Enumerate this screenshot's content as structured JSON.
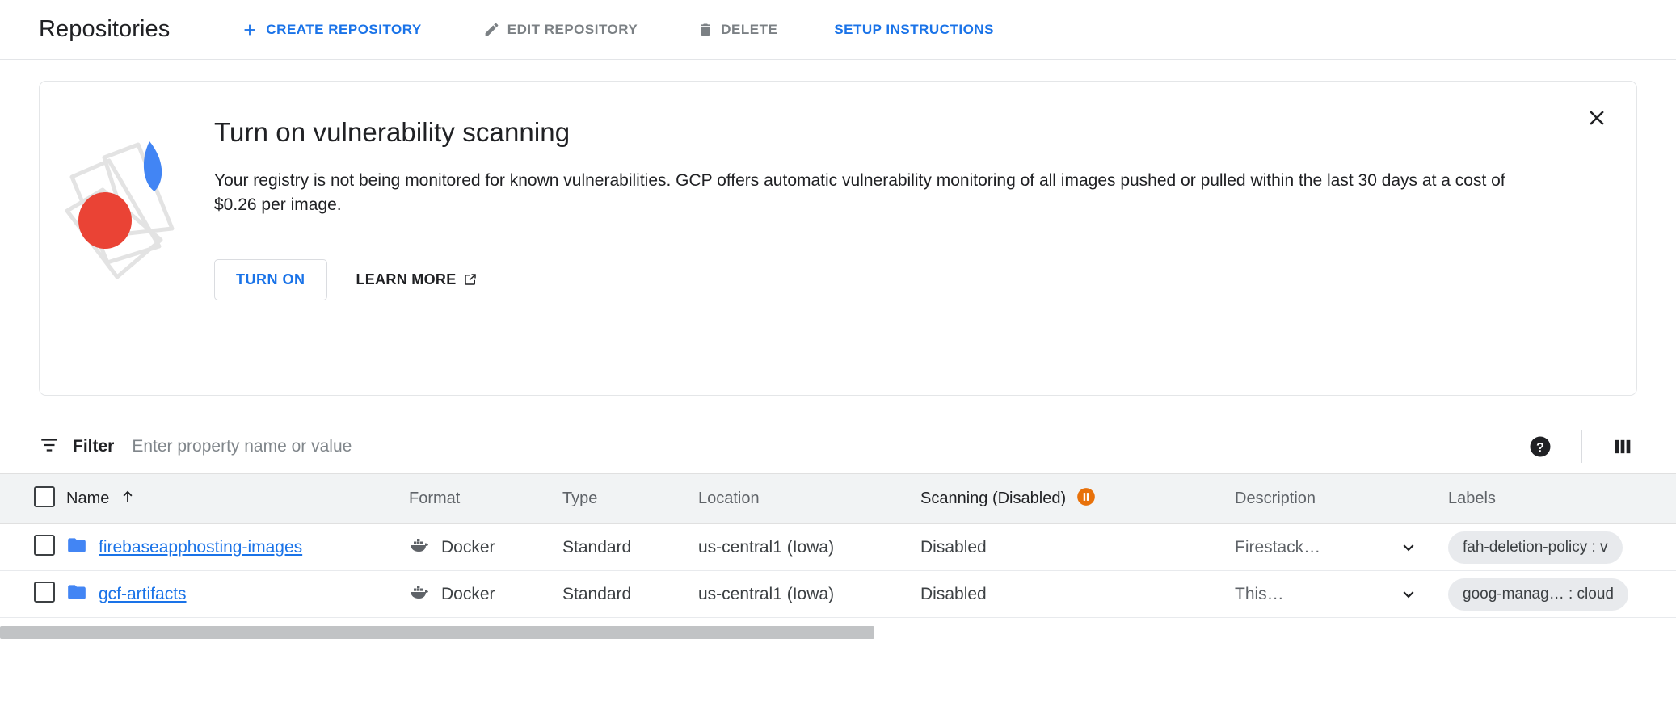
{
  "header": {
    "title": "Repositories",
    "actions": [
      {
        "label": "CREATE REPOSITORY",
        "icon": "plus-icon",
        "style": "primary"
      },
      {
        "label": "EDIT REPOSITORY",
        "icon": "pencil-icon",
        "style": "disabled"
      },
      {
        "label": "DELETE",
        "icon": "trash-icon",
        "style": "disabled"
      },
      {
        "label": "SETUP INSTRUCTIONS",
        "icon": "none",
        "style": "primary"
      }
    ]
  },
  "banner": {
    "title": "Turn on vulnerability scanning",
    "body": "Your registry is not being monitored for known vulnerabilities. GCP offers automatic vulnerability monitoring of all images pushed or pulled within the last 30 days at a cost of $0.26 per image.",
    "turn_on_label": "TURN ON",
    "learn_more_label": "LEARN MORE",
    "learn_more_icon": "external-link-icon",
    "close_icon": "close-icon",
    "illustration": {
      "name": "vulnerability-scanning-illustration",
      "accent_blue": "#4285f4",
      "accent_red": "#ea4335",
      "outline_gray": "#e0e0e0"
    }
  },
  "filter": {
    "icon": "filter-icon",
    "label": "Filter",
    "placeholder": "Enter property name or value",
    "value": "",
    "help_icon": "help-icon",
    "columns_icon": "column-settings-icon"
  },
  "table": {
    "sort_column": "Name",
    "sort_direction": "ascending",
    "sort_icon": "arrow-up-icon",
    "select_all_checked": false,
    "columns": [
      {
        "key": "name",
        "label": "Name",
        "strong": true
      },
      {
        "key": "format",
        "label": "Format",
        "strong": false
      },
      {
        "key": "type",
        "label": "Type",
        "strong": false
      },
      {
        "key": "location",
        "label": "Location",
        "strong": false
      },
      {
        "key": "scanning",
        "label": "Scanning (Disabled)",
        "strong": true,
        "badge_icon": "pause-badge-icon",
        "badge_color": "#e8710a"
      },
      {
        "key": "desc",
        "label": "Description",
        "strong": false
      },
      {
        "key": "labels",
        "label": "Labels",
        "strong": false
      }
    ],
    "rows": [
      {
        "checked": false,
        "icon": "folder-icon",
        "name": "firebaseapphosting-images",
        "format_icon": "docker-icon",
        "format": "Docker",
        "type": "Standard",
        "location": "us-central1 (Iowa)",
        "scanning": "Disabled",
        "description": "Firestack…",
        "expand_icon": "chevron-down-icon",
        "labels": "fah-deletion-policy : v"
      },
      {
        "checked": false,
        "icon": "folder-icon",
        "name": "gcf-artifacts",
        "format_icon": "docker-icon",
        "format": "Docker",
        "type": "Standard",
        "location": "us-central1 (Iowa)",
        "scanning": "Disabled",
        "description": "This…",
        "expand_icon": "chevron-down-icon",
        "labels": "goog-manag… : cloud"
      }
    ]
  },
  "scrollbar": {
    "name": "horizontal-scrollbar",
    "thumb_position_pct": 0
  },
  "colors": {
    "accent": "#1a73e8",
    "header_bg": "#f1f3f4",
    "warning": "#e8710a"
  }
}
